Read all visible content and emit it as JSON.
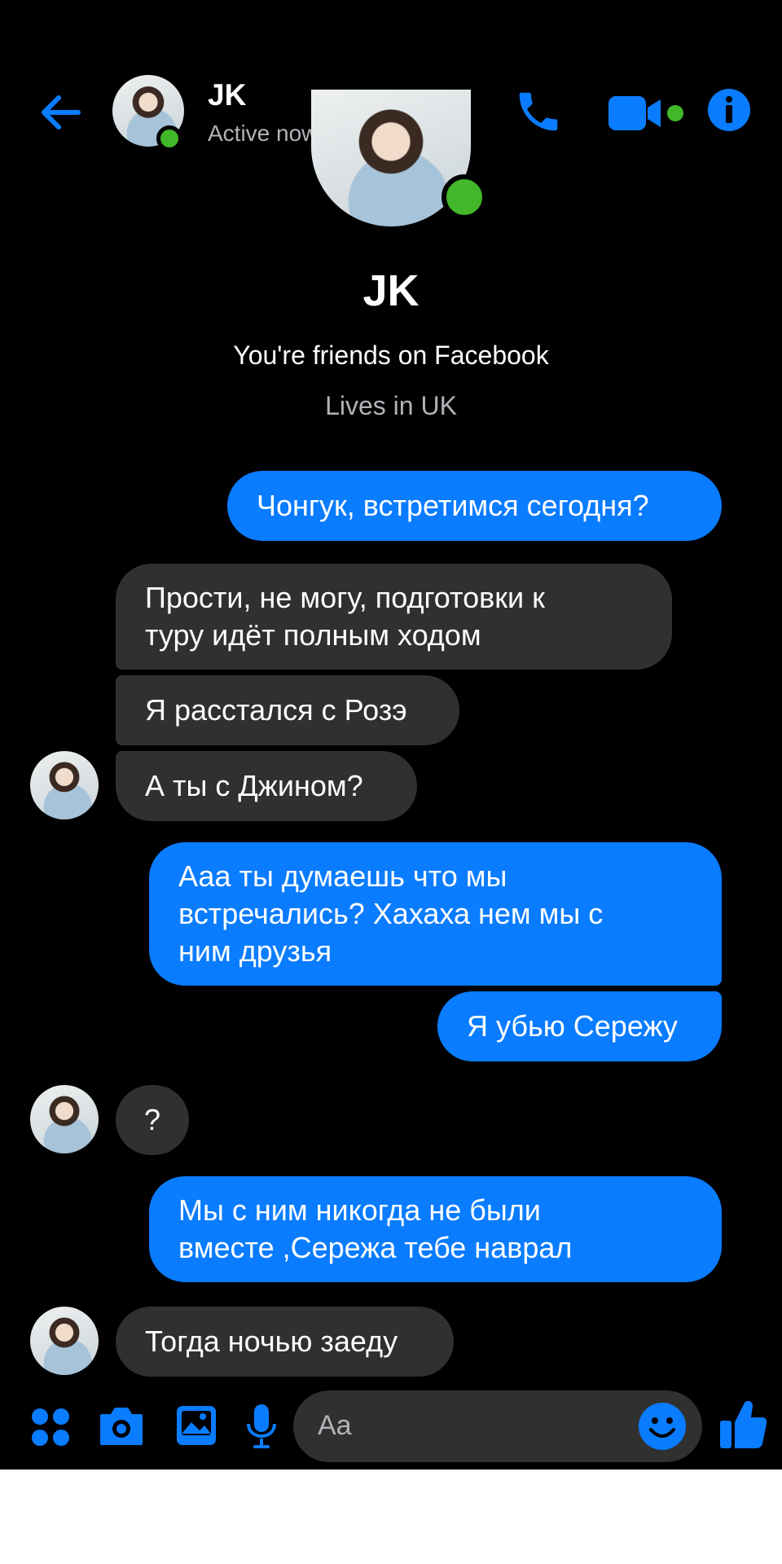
{
  "header": {
    "name": "JK",
    "status": "Active now"
  },
  "profile": {
    "name": "JK",
    "friends_text": "You're friends on Facebook",
    "lives_text": "Lives in UK"
  },
  "messages": [
    {
      "side": "out",
      "text": "Чонгук, встретимся сегодня?"
    },
    {
      "side": "in",
      "text": "Прости, не могу, подготовки к\nтуру идёт полным ходом"
    },
    {
      "side": "in",
      "text": "Я расстался с Розэ"
    },
    {
      "side": "in",
      "text": "А ты с Джином?"
    },
    {
      "side": "out",
      "text": "Ааа ты думаешь что мы\nвстречались? Хахаха нем мы с\nним друзья"
    },
    {
      "side": "out",
      "text": "Я убью Сережу"
    },
    {
      "side": "in",
      "text": "?"
    },
    {
      "side": "out",
      "text": "Мы с ним никогда не были\nвместе ,Сережа тебе наврал"
    },
    {
      "side": "in",
      "text": "Тогда ночью заеду"
    }
  ],
  "composer": {
    "placeholder": "Aa"
  },
  "icons": {
    "back": "arrow-left-icon",
    "call": "phone-icon",
    "video": "video-camera-icon",
    "info": "info-icon",
    "menu": "four-dots-icon",
    "camera": "camera-icon",
    "gallery": "image-icon",
    "mic": "microphone-icon",
    "emoji": "smiley-icon",
    "like": "thumbs-up-icon"
  },
  "colors": {
    "accent": "#0a7cff",
    "online": "#42b72a",
    "incoming_bubble": "#303030",
    "background": "#000000"
  }
}
